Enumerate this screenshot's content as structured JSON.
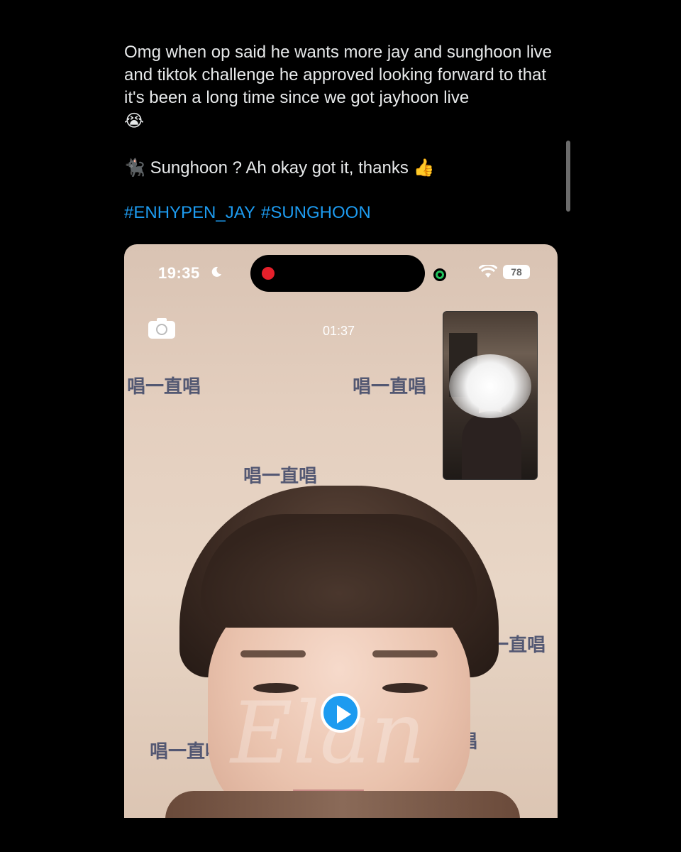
{
  "tweet": {
    "body": "Omg when op said he wants more jay and sunghoon live and tiktok challenge he approved looking forward to that it's been a long time since we got jayhoon live",
    "body_emoji": "😭",
    "reply_emoji": "🐈‍⬛",
    "reply_text": "Sunghoon ? Ah okay got it, thanks",
    "reply_thumb": "👍",
    "hashtags": [
      "#ENHYPEN_JAY",
      "#SUNGHOON"
    ]
  },
  "media": {
    "status_bar": {
      "time": "19:35",
      "battery": "78"
    },
    "call_timer": "01:37",
    "watermark": "唱一直唱",
    "script_watermark": "Elan",
    "icons": [
      "moon-icon",
      "wifi-icon",
      "camera-switch-icon",
      "play-icon"
    ],
    "colors": {
      "accent": "#1d9bf0",
      "record": "#e5202b",
      "background": "#000000"
    }
  }
}
